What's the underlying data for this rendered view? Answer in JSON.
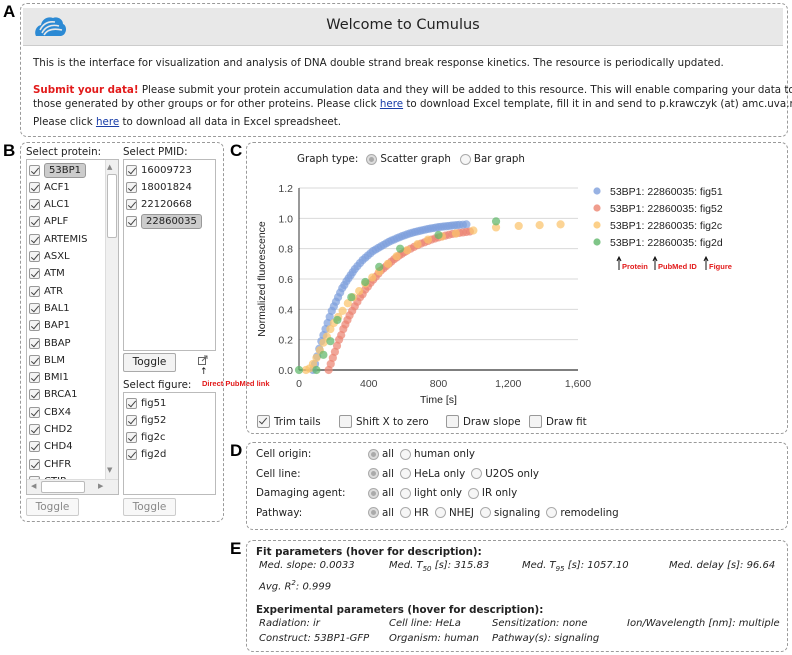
{
  "panel_labels": {
    "a": "A",
    "b": "B",
    "c": "C",
    "d": "D",
    "e": "E"
  },
  "header": {
    "logo_icon": "cloud-logo-icon",
    "title": "Welcome to Cumulus",
    "intro": "This is the interface for visualization and analysis of DNA double strand break response kinetics. The resource is periodically updated.",
    "submit_bold": "Submit your data!",
    "submit_text_1": " Please submit your protein accumulation data and they will be added to this resource. This will enable comparing your data to",
    "submit_text_2a": "those generated by other groups or for other proteins. Please click ",
    "submit_link": "here",
    "submit_text_2b": " to download Excel template, fill it in and send to p.krawczyk (at) amc.uva.nl.",
    "download_text_a": "Please click ",
    "download_link": "here",
    "download_text_b": " to download all data in Excel spreadsheet."
  },
  "selectors": {
    "protein_label": "Select protein:",
    "proteins": [
      "53BP1",
      "ACF1",
      "ALC1",
      "APLF",
      "ARTEMIS",
      "ASXL",
      "ATM",
      "ATR",
      "BAL1",
      "BAP1",
      "BBAP",
      "BLM",
      "BMI1",
      "BRCA1",
      "CBX4",
      "CHD2",
      "CHD4",
      "CHFR",
      "CTIP"
    ],
    "protein_selected": "53BP1",
    "pmid_label": "Select PMID:",
    "pmids": [
      "16009723",
      "18001824",
      "22120668",
      "22860035"
    ],
    "pmid_selected": "22860035",
    "figure_label": "Select figure:",
    "figures": [
      "fig51",
      "fig52",
      "fig2c",
      "fig2d"
    ],
    "toggle_label": "Toggle",
    "external_link_icon": "external-link-icon",
    "pubmed_annotation": "Direct PubMed link",
    "arrow_icon": "up-arrow-icon"
  },
  "graph": {
    "graph_type_label": "Graph type:",
    "graph_types": [
      {
        "label": "Scatter graph",
        "selected": true
      },
      {
        "label": "Bar graph",
        "selected": false
      }
    ],
    "options": [
      {
        "label": "Trim tails",
        "checked": true
      },
      {
        "label": "Shift X to zero",
        "checked": false
      },
      {
        "label": "Draw slope",
        "checked": false
      },
      {
        "label": "Draw fit",
        "checked": false
      }
    ],
    "legend_annotations": [
      "Protein",
      "PubMed ID",
      "Figure"
    ]
  },
  "chart_data": {
    "type": "scatter",
    "title": "",
    "xlabel": "Time [s]",
    "ylabel": "Normalized fluorescence",
    "xlim": [
      0,
      1600
    ],
    "ylim": [
      0,
      1.2
    ],
    "xticks": [
      0,
      400,
      800,
      1200,
      1600
    ],
    "xtick_labels": [
      "0",
      "400",
      "800",
      "1,200",
      "1,600"
    ],
    "yticks": [
      0,
      0.2,
      0.4,
      0.6,
      0.8,
      1.0,
      1.2
    ],
    "ytick_labels": [
      "0.0",
      "0.2",
      "0.4",
      "0.6",
      "0.8",
      "1.0",
      "1.2"
    ],
    "grid": true,
    "legend_position": "right",
    "series": [
      {
        "name": "53BP1: 22860035: fig51",
        "color": "#7e9fdc",
        "x": [
          80,
          92,
          104,
          116,
          128,
          140,
          152,
          164,
          176,
          188,
          200,
          212,
          224,
          236,
          248,
          260,
          272,
          284,
          296,
          308,
          320,
          335,
          350,
          365,
          380,
          395,
          410,
          425,
          440,
          455,
          470,
          485,
          500,
          515,
          530,
          545,
          560,
          575,
          590,
          605,
          620,
          635,
          650,
          665,
          680,
          695,
          710,
          725,
          740,
          755,
          770,
          785,
          800,
          815,
          830,
          845,
          860,
          875,
          890,
          905,
          920,
          940,
          960
        ],
        "y": [
          0.0,
          0.04,
          0.09,
          0.14,
          0.19,
          0.23,
          0.27,
          0.31,
          0.35,
          0.39,
          0.42,
          0.45,
          0.48,
          0.51,
          0.54,
          0.56,
          0.585,
          0.605,
          0.625,
          0.645,
          0.665,
          0.685,
          0.705,
          0.725,
          0.74,
          0.755,
          0.77,
          0.785,
          0.795,
          0.805,
          0.815,
          0.825,
          0.835,
          0.845,
          0.853,
          0.86,
          0.868,
          0.875,
          0.882,
          0.888,
          0.894,
          0.9,
          0.905,
          0.91,
          0.914,
          0.918,
          0.922,
          0.926,
          0.93,
          0.933,
          0.936,
          0.939,
          0.942,
          0.944,
          0.946,
          0.948,
          0.95,
          0.952,
          0.954,
          0.955,
          0.957,
          0.958,
          0.96
        ]
      },
      {
        "name": "53BP1: 22860035: fig52",
        "color": "#ec8471",
        "x": [
          170,
          182,
          194,
          206,
          218,
          230,
          242,
          254,
          266,
          278,
          290,
          305,
          320,
          335,
          350,
          365,
          380,
          395,
          410,
          425,
          440,
          455,
          470,
          485,
          500,
          515,
          530,
          545,
          560,
          575,
          590,
          605,
          620,
          640,
          660,
          680,
          700,
          720,
          740,
          760,
          780,
          800,
          820,
          840,
          860,
          880,
          900,
          920,
          940,
          960,
          980
        ],
        "y": [
          0.0,
          0.04,
          0.08,
          0.12,
          0.16,
          0.2,
          0.23,
          0.27,
          0.3,
          0.33,
          0.36,
          0.39,
          0.42,
          0.45,
          0.48,
          0.5,
          0.53,
          0.55,
          0.575,
          0.595,
          0.615,
          0.635,
          0.655,
          0.67,
          0.685,
          0.7,
          0.715,
          0.73,
          0.742,
          0.755,
          0.766,
          0.777,
          0.787,
          0.8,
          0.812,
          0.823,
          0.833,
          0.842,
          0.851,
          0.86,
          0.867,
          0.874,
          0.88,
          0.886,
          0.892,
          0.897,
          0.9,
          0.904,
          0.907,
          0.91,
          0.913
        ]
      },
      {
        "name": "53BP1: 22860035: fig2c",
        "color": "#fbc46c",
        "x": [
          40,
          60,
          80,
          100,
          120,
          140,
          160,
          180,
          200,
          225,
          250,
          280,
          310,
          345,
          380,
          420,
          460,
          510,
          560,
          620,
          680,
          740,
          820,
          900,
          1000,
          1130,
          1260,
          1380,
          1500
        ],
        "y": [
          0.0,
          0.01,
          0.04,
          0.08,
          0.13,
          0.18,
          0.22,
          0.27,
          0.31,
          0.35,
          0.39,
          0.44,
          0.48,
          0.52,
          0.57,
          0.61,
          0.65,
          0.7,
          0.75,
          0.79,
          0.83,
          0.86,
          0.88,
          0.9,
          0.92,
          0.94,
          0.95,
          0.955,
          0.96
        ]
      },
      {
        "name": "53BP1: 22860035: fig2d",
        "color": "#5fb76a",
        "x": [
          0,
          100,
          140,
          180,
          220,
          300,
          380,
          460,
          580,
          800,
          1130
        ],
        "y": [
          0.0,
          0.0,
          0.1,
          0.19,
          0.33,
          0.48,
          0.58,
          0.68,
          0.8,
          0.89,
          0.98
        ]
      }
    ]
  },
  "filters": [
    {
      "label": "Cell origin:",
      "options": [
        "all",
        "human only"
      ],
      "selected": "all"
    },
    {
      "label": "Cell line:",
      "options": [
        "all",
        "HeLa only",
        "U2OS only"
      ],
      "selected": "all"
    },
    {
      "label": "Damaging agent:",
      "options": [
        "all",
        "light only",
        "IR only"
      ],
      "selected": "all"
    },
    {
      "label": "Pathway:",
      "options": [
        "all",
        "HR",
        "NHEJ",
        "signaling",
        "remodeling"
      ],
      "selected": "all"
    }
  ],
  "parameters": {
    "fit_heading": "Fit parameters (hover for description):",
    "fit": [
      {
        "label": "Med. slope: ",
        "value": "0.0033"
      },
      {
        "label": "Med. T",
        "sub": "50",
        "label2": " [s]: ",
        "value": "315.83"
      },
      {
        "label": "Med. T",
        "sub": "95",
        "label2": " [s]: ",
        "value": "1057.10"
      },
      {
        "label": "Med. delay [s]: ",
        "value": "96.64"
      },
      {
        "label": "Avg. R",
        "sup": "2",
        "label2": ": ",
        "value": "0.999"
      }
    ],
    "exp_heading": "Experimental parameters (hover for description):",
    "experimental": [
      "Radiation: ir",
      "Cell line: HeLa",
      "Sensitization: none",
      "Ion/Wavelength [nm]: multiple",
      "Construct: 53BP1-GFP",
      "Organism: human",
      "Pathway(s): signaling"
    ]
  }
}
